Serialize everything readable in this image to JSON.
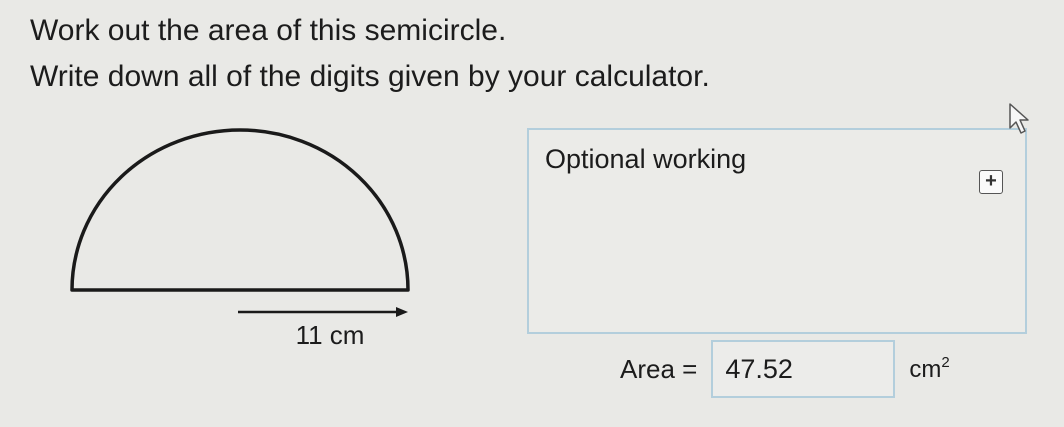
{
  "question": {
    "line1": "Work out the area of this semicircle.",
    "line2": "Write down all of the digits given by your calculator."
  },
  "diagram": {
    "dimension_label": "11 cm"
  },
  "working": {
    "label": "Optional working",
    "expand_symbol": "+"
  },
  "answer": {
    "label": "Area =",
    "value": "47.52",
    "unit": "cm",
    "unit_exponent": "2"
  },
  "colors": {
    "background": "#e9e9e6",
    "box_border": "#b3cedc",
    "text": "#1c1c1c"
  }
}
